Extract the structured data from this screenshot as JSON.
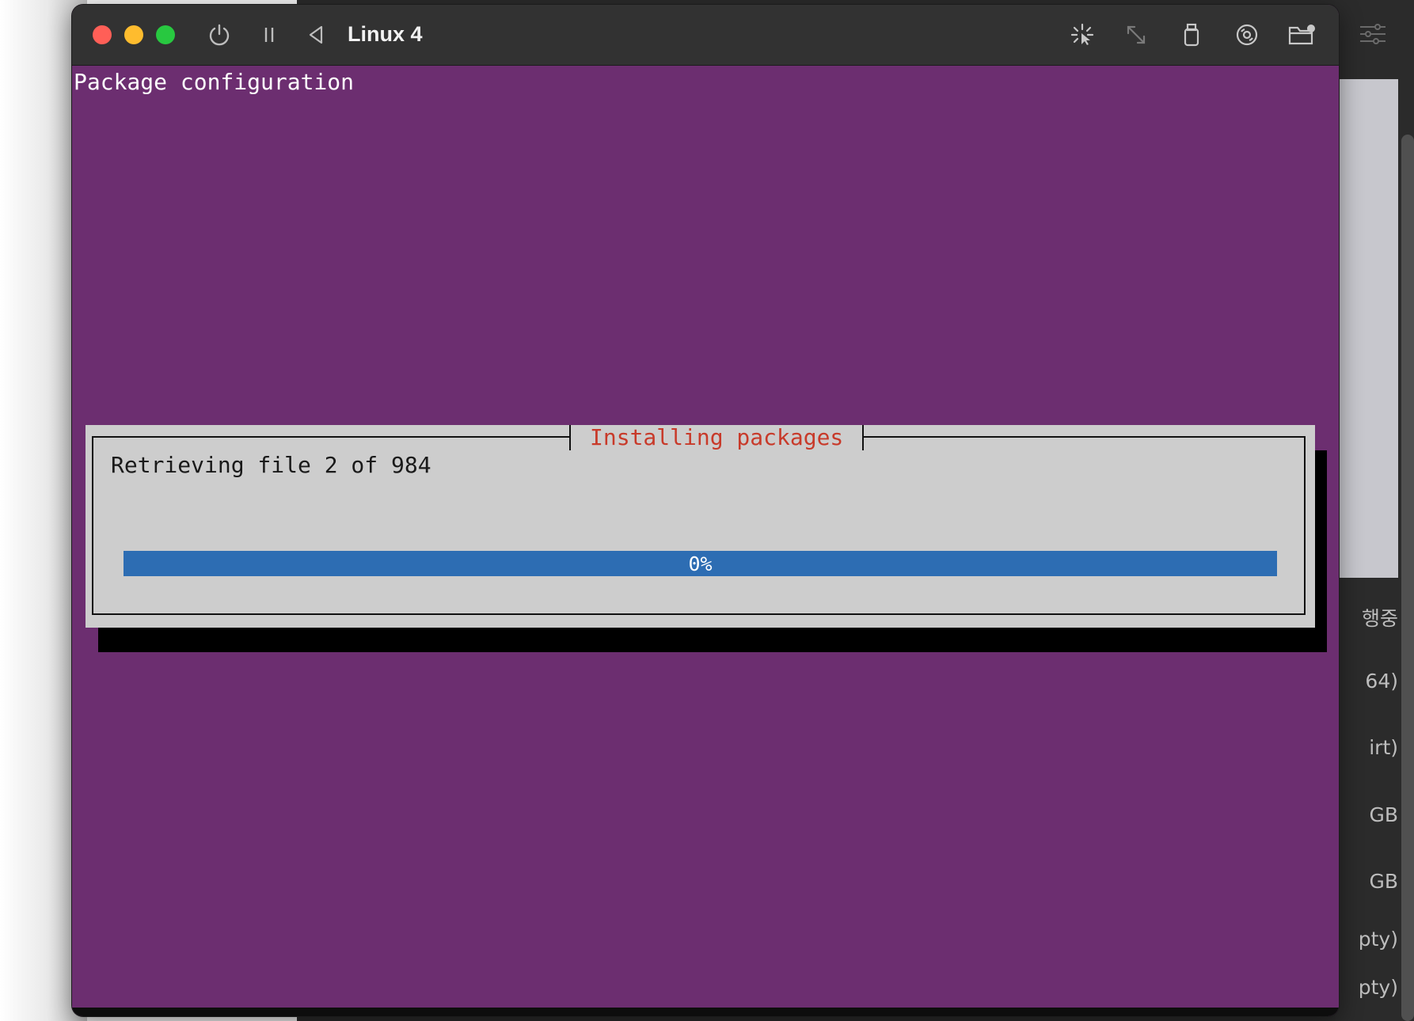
{
  "window": {
    "title": "Linux 4"
  },
  "toolbar": {
    "icons": [
      "power-icon",
      "pause-icon",
      "back-icon",
      "capture-cursor-icon",
      "resize-icon",
      "usb-icon",
      "disc-icon",
      "shared-folder-icon"
    ]
  },
  "screen": {
    "header": "Package configuration",
    "dialog": {
      "title": "Installing packages",
      "message": "Retrieving file 2 of 984",
      "progress_label": "0%",
      "progress_value": 0
    }
  },
  "background_window": {
    "side_texts": [
      "행중",
      "64)",
      "irt)",
      "GB",
      "GB",
      "pty)",
      "pty)"
    ]
  },
  "colors": {
    "terminal_bg": "#6c2e70",
    "dialog_bg": "#cdcdcd",
    "dialog_title": "#c83a2a",
    "progress": "#2d6db3"
  }
}
